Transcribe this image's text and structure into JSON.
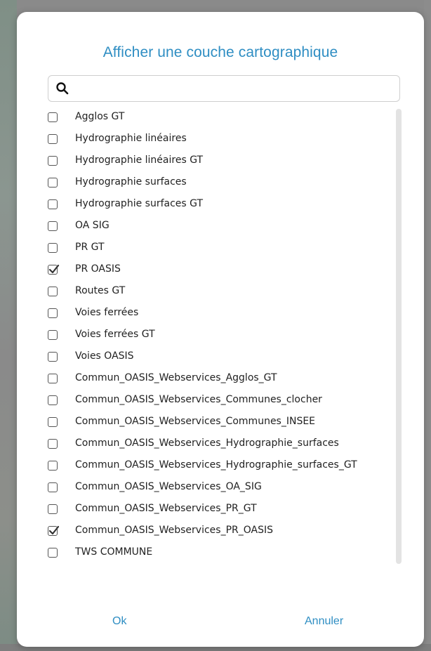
{
  "dialog": {
    "title": "Afficher une couche cartographique",
    "search": {
      "value": "",
      "placeholder": ""
    },
    "layers": [
      {
        "label": "Agglos GT",
        "checked": false
      },
      {
        "label": "Hydrographie linéaires",
        "checked": false
      },
      {
        "label": "Hydrographie linéaires GT",
        "checked": false
      },
      {
        "label": "Hydrographie surfaces",
        "checked": false
      },
      {
        "label": "Hydrographie surfaces GT",
        "checked": false
      },
      {
        "label": "OA SIG",
        "checked": false
      },
      {
        "label": "PR GT",
        "checked": false
      },
      {
        "label": "PR OASIS",
        "checked": true
      },
      {
        "label": "Routes GT",
        "checked": false
      },
      {
        "label": "Voies ferrées",
        "checked": false
      },
      {
        "label": "Voies ferrées GT",
        "checked": false
      },
      {
        "label": "Voies OASIS",
        "checked": false
      },
      {
        "label": "Commun_OASIS_Webservices_Agglos_GT",
        "checked": false
      },
      {
        "label": "Commun_OASIS_Webservices_Communes_clocher",
        "checked": false
      },
      {
        "label": "Commun_OASIS_Webservices_Communes_INSEE",
        "checked": false
      },
      {
        "label": "Commun_OASIS_Webservices_Hydrographie_surfaces",
        "checked": false
      },
      {
        "label": "Commun_OASIS_Webservices_Hydrographie_surfaces_GT",
        "checked": false
      },
      {
        "label": "Commun_OASIS_Webservices_OA_SIG",
        "checked": false
      },
      {
        "label": "Commun_OASIS_Webservices_PR_GT",
        "checked": false
      },
      {
        "label": "Commun_OASIS_Webservices_PR_OASIS",
        "checked": true
      },
      {
        "label": "TWS COMMUNE",
        "checked": false
      }
    ],
    "ok_label": "Ok",
    "cancel_label": "Annuler"
  },
  "colors": {
    "accent": "#2f8ec3",
    "overlay": "#8a8a8a",
    "checkbox_border": "#555555",
    "scrollbar_thumb": "#e3e3e3"
  }
}
